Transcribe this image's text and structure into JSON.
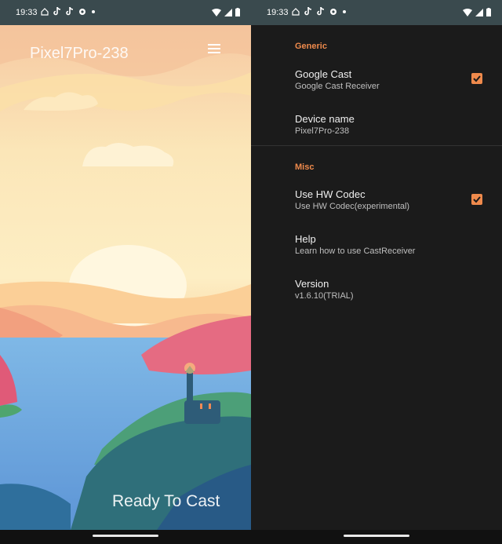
{
  "status": {
    "time": "19:33"
  },
  "left": {
    "app_title": "Pixel7Pro-238",
    "status_text": "Ready To Cast"
  },
  "settings": {
    "generic_header": "Generic",
    "google_cast_title": "Google Cast",
    "google_cast_sub": "Google Cast Receiver",
    "google_cast_checked": true,
    "device_name_title": "Device name",
    "device_name_sub": "Pixel7Pro-238",
    "misc_header": "Misc",
    "hw_codec_title": "Use HW Codec",
    "hw_codec_sub": "Use HW Codec(experimental)",
    "hw_codec_checked": true,
    "help_title": "Help",
    "help_sub": "Learn how to use CastReceiver",
    "version_title": "Version",
    "version_sub": "v1.6.10(TRIAL)"
  },
  "colors": {
    "accent": "#ef8a4c",
    "statusbar": "#3a4a4e",
    "panel": "#1b1b1b"
  },
  "icons": [
    "home-icon",
    "tiktok-icon",
    "tiktok-icon",
    "gear-icon",
    "dot-icon",
    "wifi-icon",
    "signal-icon",
    "battery-icon",
    "menu-icon",
    "checkbox-icon"
  ]
}
